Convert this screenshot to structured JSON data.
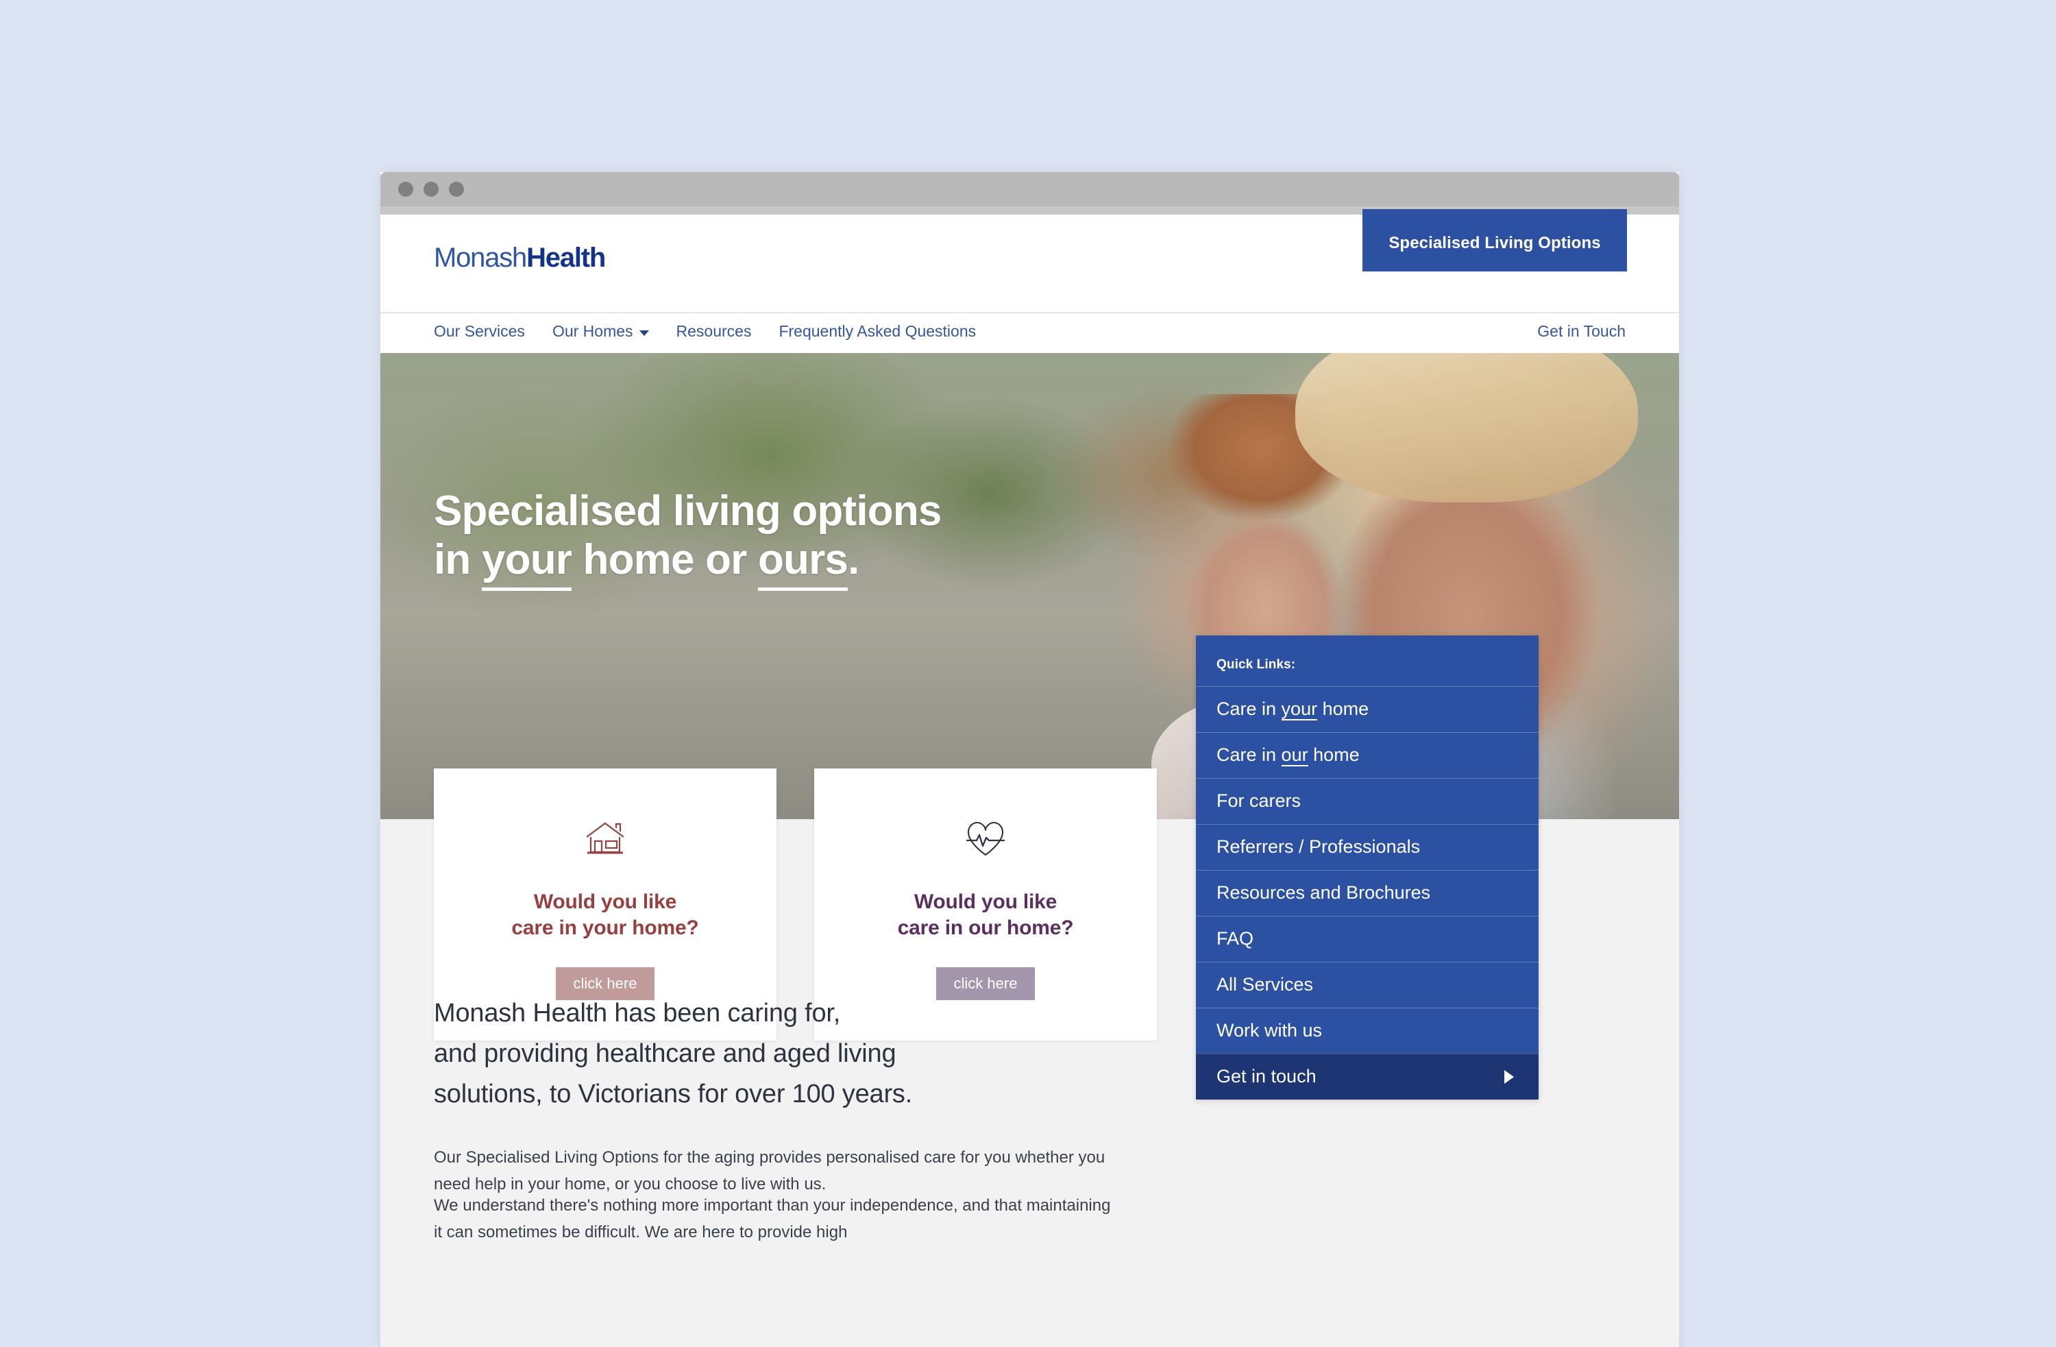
{
  "colors": {
    "brand_blue": "#2c51a3",
    "brand_blue_dark": "#1e3573",
    "logo_light": "#2f55a6",
    "logo_dark": "#14348c",
    "card_home_text": "#96403f",
    "card_ours_text": "#5b2f60",
    "card_home_btn": "#c19a9a",
    "card_ours_btn": "#a395ab",
    "page_bg": "#f2f2f2",
    "canvas_bg": "#dce3f2"
  },
  "browser": {
    "dots": [
      "dot-red",
      "dot-yellow",
      "dot-green"
    ]
  },
  "header": {
    "logo": {
      "first": "Monash",
      "second": "Health"
    },
    "cta_button": "Specialised Living Options"
  },
  "nav": {
    "items": [
      {
        "label": "Our Services",
        "has_caret": false
      },
      {
        "label": "Our Homes",
        "has_caret": true
      },
      {
        "label": "Resources",
        "has_caret": false
      },
      {
        "label": "Frequently Asked Questions",
        "has_caret": false
      }
    ],
    "right_link": "Get in Touch"
  },
  "hero": {
    "title_line1": "Specialised living options",
    "title_line2_a": "in ",
    "title_line2_underlined1": "your",
    "title_line2_b": " home or ",
    "title_line2_underlined2": "ours",
    "title_line2_c": "."
  },
  "cards": [
    {
      "icon": "house-icon",
      "title_line1": "Would you like",
      "title_line2": "care in your home?",
      "button": "click here"
    },
    {
      "icon": "heart-pulse-icon",
      "title_line1": "Would you like",
      "title_line2": "care in our home?",
      "button": "click here"
    }
  ],
  "quick_links": {
    "heading": "Quick Links:",
    "items": [
      {
        "pre": "Care in ",
        "underlined": "your",
        "post": " home",
        "active": false,
        "arrow": false
      },
      {
        "pre": "Care in ",
        "underlined": "our",
        "post": " home",
        "active": false,
        "arrow": false
      },
      {
        "pre": "For carers",
        "underlined": "",
        "post": "",
        "active": false,
        "arrow": false
      },
      {
        "pre": "Referrers / Professionals",
        "underlined": "",
        "post": "",
        "active": false,
        "arrow": false
      },
      {
        "pre": "Resources and Brochures",
        "underlined": "",
        "post": "",
        "active": false,
        "arrow": false
      },
      {
        "pre": "FAQ",
        "underlined": "",
        "post": "",
        "active": false,
        "arrow": false
      },
      {
        "pre": "All Services",
        "underlined": "",
        "post": "",
        "active": false,
        "arrow": false
      },
      {
        "pre": "Work with us",
        "underlined": "",
        "post": "",
        "active": false,
        "arrow": false
      },
      {
        "pre": "Get in touch",
        "underlined": "",
        "post": "",
        "active": true,
        "arrow": true
      }
    ]
  },
  "content": {
    "lede_line1": "Monash Health has been caring for,",
    "lede_line2": "and providing healthcare and aged living",
    "lede_line3": "solutions, to Victorians for over 100 years.",
    "paragraph_1": "Our Specialised Living Options for the aging provides personalised care for you whether you need help in your home, or you choose to live with us.",
    "paragraph_2": "We understand there's nothing more important than your independence, and that maintaining it can sometimes be difficult. We are here to provide high"
  }
}
